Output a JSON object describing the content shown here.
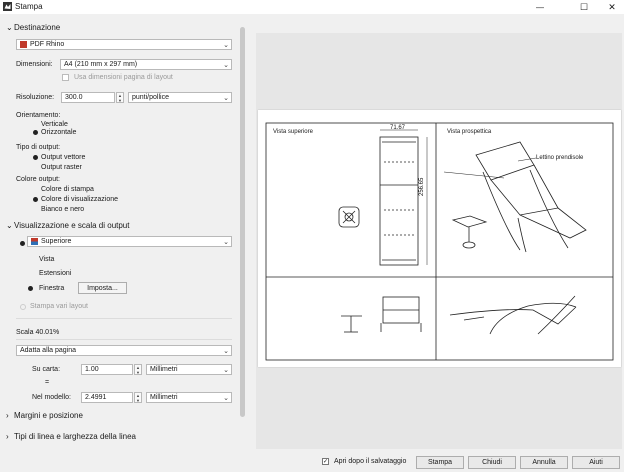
{
  "window": {
    "title": "Stampa",
    "minimize": "—",
    "maximize": "☐",
    "close": "✕"
  },
  "destination": {
    "section_label": "Destinazione",
    "printer": "PDF Rhino",
    "size_label": "Dimensioni:",
    "size_value": "A4 (210 mm x 297 mm)",
    "use_layout_label": "Usa dimensioni pagina di layout",
    "resolution_label": "Risoluzione:",
    "resolution_value": "300.0",
    "resolution_unit": "punti/pollice",
    "orientation_label": "Orientamento:",
    "orientation_options": [
      "Verticale",
      "Orizzontale"
    ],
    "output_type_label": "Tipo di output:",
    "output_type_options": [
      "Output vettore",
      "Output raster"
    ],
    "output_color_label": "Colore output:",
    "output_color_options": [
      "Colore di stampa",
      "Colore di visualizzazione",
      "Bianco e nero"
    ]
  },
  "view_scale": {
    "section_label": "Visualizzazione e scala di output",
    "viewport": "Superiore",
    "area_options": [
      "Vista",
      "Estensioni",
      "Finestra"
    ],
    "imposta_label": "Imposta...",
    "multi_layout_label": "Stampa vari layout",
    "scale_label": "Scala 40.01%",
    "fit_value": "Adatta alla pagina",
    "on_paper_label": "Su carta:",
    "on_paper_value": "1.00",
    "on_paper_unit": "Millimetri",
    "equals": "=",
    "in_model_label": "Nel modello:",
    "in_model_value": "2.4991",
    "in_model_unit": "Millimetri"
  },
  "sections_collapsed": [
    "Margini e posizione",
    "Tipi di linea e larghezza della linea"
  ],
  "preview": {
    "top_view_label": "Vista superiore",
    "perspective_label": "Vista prospettica",
    "dim_width": "71.67",
    "dim_height": "256.65",
    "annotation": "Lettino prendisole"
  },
  "footer": {
    "open_after_save_label": "Apri dopo il salvataggio",
    "open_after_save_checked": "✓",
    "buttons": [
      "Stampa",
      "Chiudi",
      "Annulla",
      "Aiuti"
    ]
  },
  "icons": {
    "printer": "pdf-printer-icon",
    "viewport": "viewport-grid-icon"
  }
}
